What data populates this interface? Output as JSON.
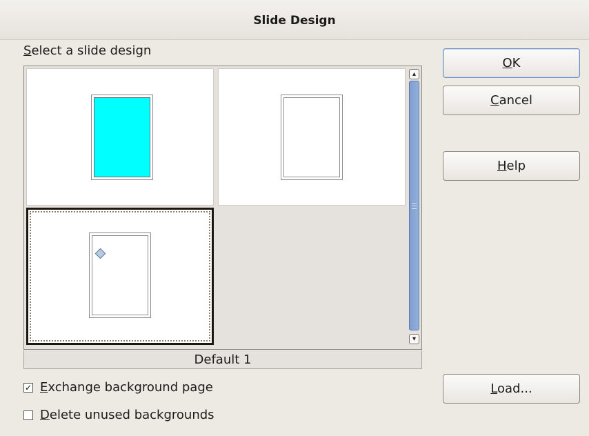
{
  "dialog": {
    "title": "Slide Design"
  },
  "gallery": {
    "label_accel": "S",
    "label_rest": "elect a slide design",
    "selected_caption": "Default 1"
  },
  "options": {
    "exchange": {
      "accel": "E",
      "rest": "xchange background page",
      "checked_glyph": "✓"
    },
    "delete": {
      "accel": "D",
      "rest": "elete unused backgrounds",
      "checked_glyph": ""
    }
  },
  "buttons": {
    "ok": {
      "accel": "O",
      "rest": "K"
    },
    "cancel": {
      "accel": "C",
      "rest": "ancel"
    },
    "help": {
      "accel": "H",
      "rest": "elp"
    },
    "load": {
      "accel": "L",
      "rest": "oad..."
    }
  },
  "scrollbar": {
    "up_glyph": "▴",
    "down_glyph": "▾"
  },
  "colors": {
    "cyan_design": "#00ffff",
    "accent": "#7f9ed0"
  }
}
